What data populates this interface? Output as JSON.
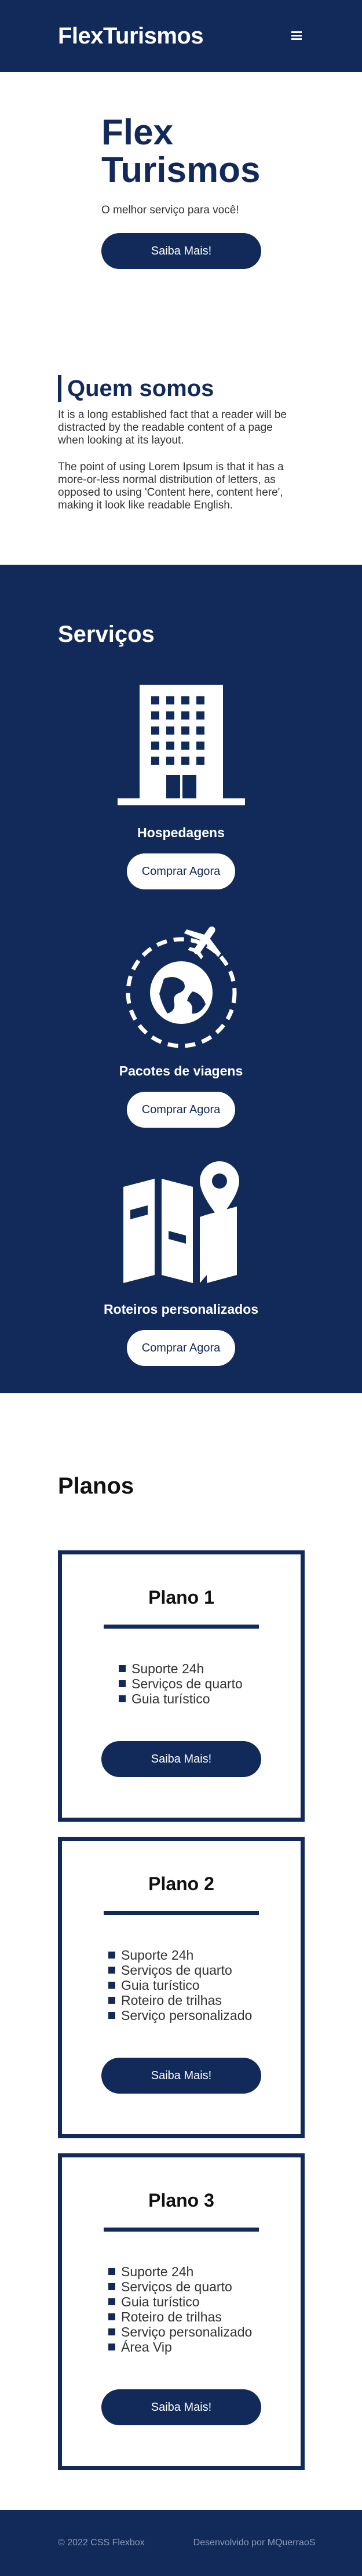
{
  "header": {
    "logo": "FlexTurismos",
    "menu_icon": "hamburger-icon"
  },
  "hero": {
    "title": "Flex Turismos",
    "subtitle": "O melhor serviço para você!",
    "button_label": "Saiba Mais!"
  },
  "about": {
    "title": "Quem somos",
    "paragraphs": [
      "It is a long established fact that a reader will be distracted by the readable content of a page when looking at its layout.",
      "The point of using Lorem Ipsum is that it has a more-or-less normal distribution of letters, as opposed to using 'Content here, content here', making it look like readable English."
    ]
  },
  "services": {
    "title": "Serviços",
    "items": [
      {
        "name": "Hospedagens",
        "button_label": "Comprar Agora",
        "icon": "building-icon"
      },
      {
        "name": "Pacotes de viagens",
        "button_label": "Comprar Agora",
        "icon": "globe-airplane-icon"
      },
      {
        "name": "Roteiros personalizados",
        "button_label": "Comprar Agora",
        "icon": "map-pin-icon"
      }
    ]
  },
  "plans": {
    "title": "Planos",
    "items": [
      {
        "name": "Plano 1",
        "features": [
          "Suporte 24h",
          "Serviços de quarto",
          "Guia turístico"
        ],
        "button_label": "Saiba Mais!"
      },
      {
        "name": "Plano 2",
        "features": [
          "Suporte 24h",
          "Serviços de quarto",
          "Guia turístico",
          "Roteiro de trilhas",
          "Serviço personalizado"
        ],
        "button_label": "Saiba Mais!"
      },
      {
        "name": "Plano 3",
        "features": [
          "Suporte 24h",
          "Serviços de quarto",
          "Guia turístico",
          "Roteiro de trilhas",
          "Serviço personalizado",
          "Área Vip"
        ],
        "button_label": "Saiba Mais!"
      }
    ]
  },
  "footer": {
    "copyright": "© 2022 CSS Flexbox",
    "developer": "Desenvolvido por MQuerraoS"
  },
  "colors": {
    "primary": "#122a5a",
    "background": "#ffffff",
    "footer_text": "#8a98b8"
  }
}
